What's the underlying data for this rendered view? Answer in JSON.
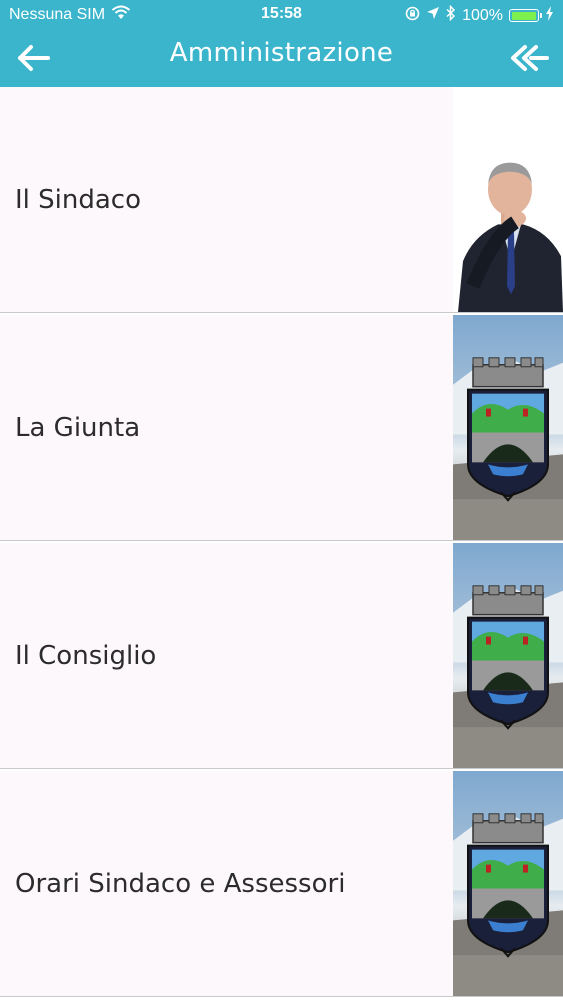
{
  "status_bar": {
    "carrier": "Nessuna SIM",
    "time": "15:58",
    "battery_percent": "100%",
    "battery_level": 1.0
  },
  "header": {
    "title": "Amministrazione",
    "back_icon": "arrow-left-icon",
    "home_icon": "double-chevron-left-icon"
  },
  "items": [
    {
      "label": "Il Sindaco",
      "thumbnail": "mayor-portrait"
    },
    {
      "label": "La Giunta",
      "thumbnail": "municipal-crest"
    },
    {
      "label": "Il Consiglio",
      "thumbnail": "municipal-crest"
    },
    {
      "label": "Orari Sindaco e Assessori",
      "thumbnail": "municipal-crest"
    }
  ],
  "colors": {
    "header_bg": "#3bb5cc",
    "row_bg": "#fdf8fb",
    "battery_fill": "#7ef04e"
  }
}
